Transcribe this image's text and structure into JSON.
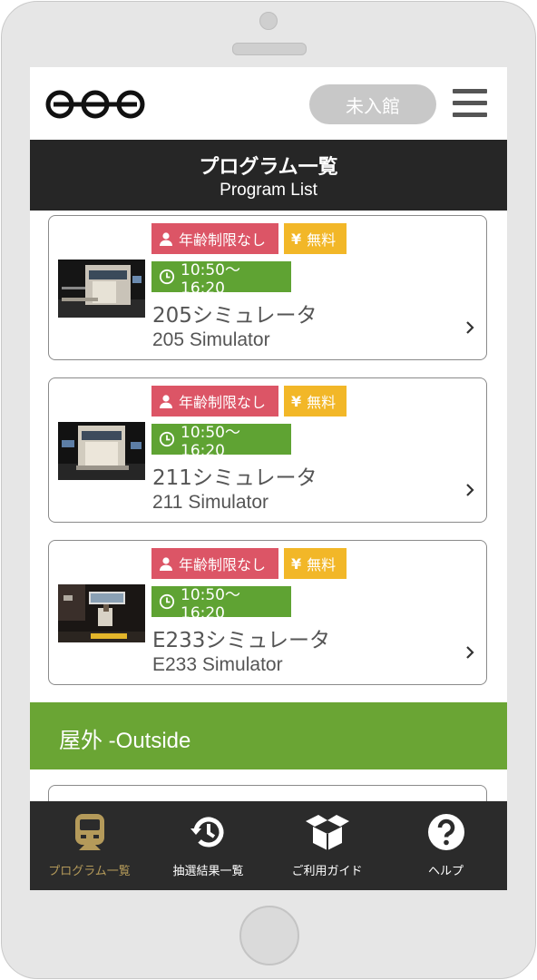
{
  "header": {
    "status_button": "未入館"
  },
  "title": {
    "jp": "プログラム一覧",
    "en": "Program List"
  },
  "programs": [
    {
      "age": "年齢制限なし",
      "fee": "無料",
      "time": "10:50～16:20",
      "name_jp": "205シミュレータ",
      "name_en": "205 Simulator"
    },
    {
      "age": "年齢制限なし",
      "fee": "無料",
      "time": "10:50～16:20",
      "name_jp": "211シミュレータ",
      "name_en": "211 Simulator"
    },
    {
      "age": "年齢制限なし",
      "fee": "無料",
      "time": "10:50～16:20",
      "name_jp": "E233シミュレータ",
      "name_en": "E233 Simulator"
    }
  ],
  "section": {
    "outside": "屋外 -Outside"
  },
  "tabs": [
    {
      "label": "プログラム一覧",
      "icon": "train-icon",
      "active": true
    },
    {
      "label": "抽選結果一覧",
      "icon": "history-icon",
      "active": false
    },
    {
      "label": "ご利用ガイド",
      "icon": "open-box-icon",
      "active": false
    },
    {
      "label": "ヘルプ",
      "icon": "help-icon",
      "active": false
    }
  ],
  "colors": {
    "age_badge": "#dc5566",
    "fee_badge": "#f2b728",
    "time_badge": "#5fa333",
    "section_green": "#6aa534",
    "dark_bar": "#262626",
    "active_tab": "#b49a5a"
  }
}
